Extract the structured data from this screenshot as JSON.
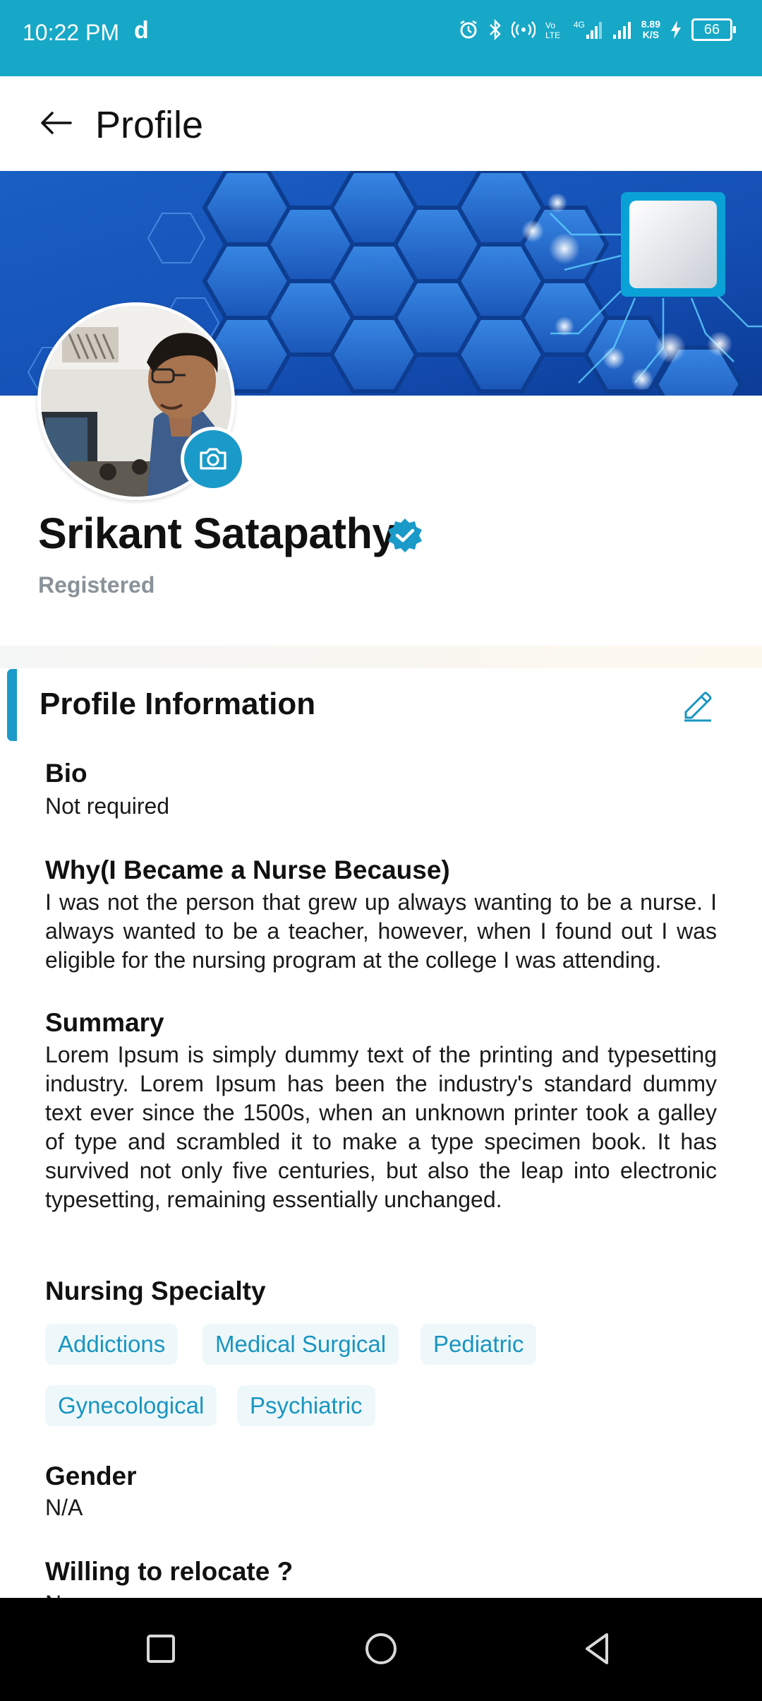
{
  "status_bar": {
    "time": "10:22 PM",
    "app_glyph": "d",
    "net_speed_value": "8.89",
    "net_speed_unit": "K/S",
    "battery": "66",
    "icons": [
      "alarm-icon",
      "bluetooth-icon",
      "hotspot-icon",
      "volte-icon",
      "signal-4g-icon",
      "signal-icon",
      "charging-icon",
      "battery-icon"
    ]
  },
  "header": {
    "title": "Profile",
    "back_icon": "arrow-left-icon"
  },
  "profile": {
    "name": "Srikant Satapathy",
    "status": "Registered",
    "verified_icon": "verified-badge-icon",
    "camera_icon": "camera-icon"
  },
  "section": {
    "title": "Profile Information",
    "edit_icon": "pencil-icon",
    "bio": {
      "label": "Bio",
      "value": "Not required"
    },
    "why": {
      "label": "Why(I Became a Nurse Because)",
      "value": "I was not the person that grew up always wanting to be a nurse. I always wanted to be a teacher, however, when I found out I was eligible for the nursing program at the college I was attending."
    },
    "summary": {
      "label": "Summary",
      "value": "Lorem Ipsum is simply dummy text of the printing and typesetting industry. Lorem Ipsum has been the industry's standard dummy text ever since the 1500s, when an unknown printer took a galley of type and scrambled it to make a type specimen book. It has survived not only five centuries, but also the leap into electronic typesetting, remaining essentially unchanged."
    },
    "specialty": {
      "label": "Nursing Specialty",
      "chips": [
        "Addictions",
        "Medical Surgical",
        "Pediatric",
        "Gynecological",
        "Psychiatric"
      ]
    },
    "gender": {
      "label": "Gender",
      "value": "N/A"
    },
    "relocate": {
      "label": "Willing to relocate ?",
      "value": "No"
    }
  },
  "nav": {
    "icons": [
      "recents-square-icon",
      "home-circle-icon",
      "back-triangle-icon"
    ]
  },
  "colors": {
    "accent": "#17a8c7",
    "link": "#1a95c1",
    "chip_bg": "#eef8fb"
  }
}
